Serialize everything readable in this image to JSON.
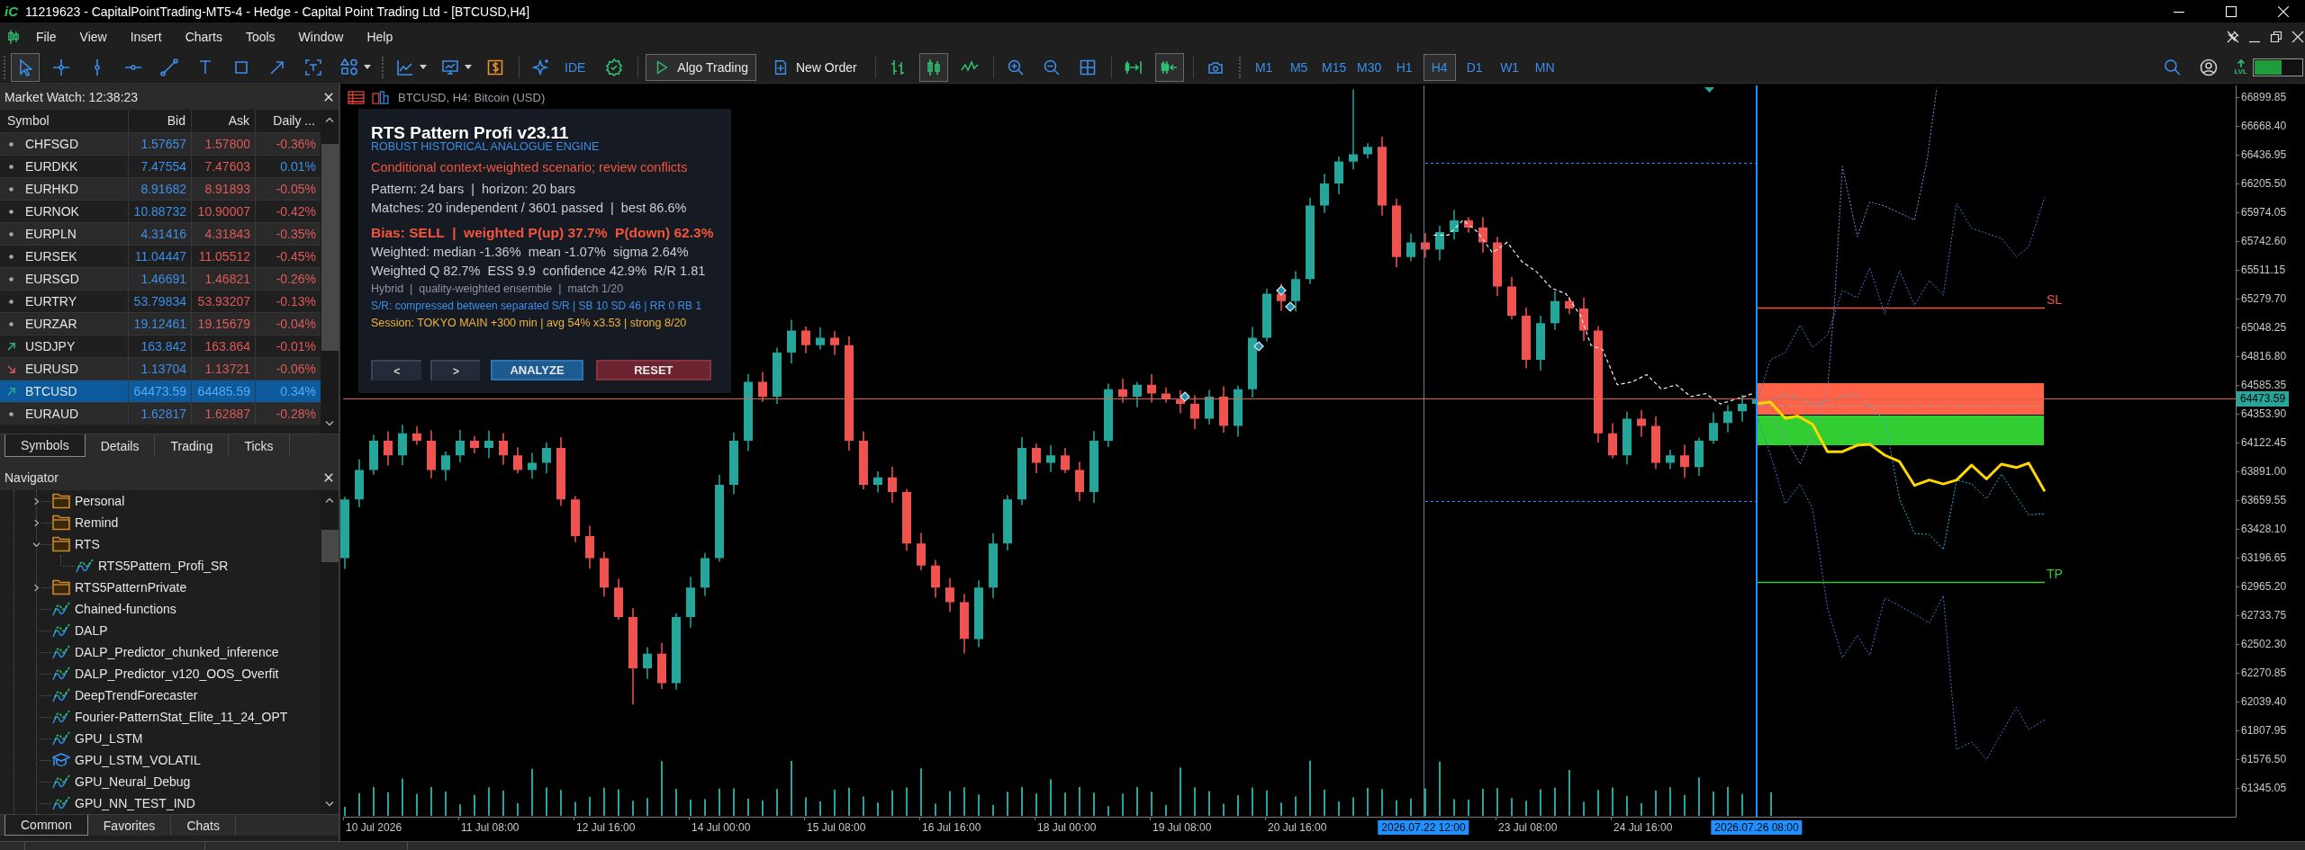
{
  "title_bar": {
    "logo": "iC",
    "title": "11219623 - CapitalPointTrading-MT5-4 - Hedge - Capital Point Trading Ltd - [BTCUSD,H4]"
  },
  "menu": [
    "File",
    "View",
    "Insert",
    "Charts",
    "Tools",
    "Window",
    "Help"
  ],
  "toolbar": {
    "drawing_tools": [
      {
        "kind": "cursor",
        "selected": true
      },
      {
        "kind": "crosshair",
        "selected": false
      },
      {
        "kind": "vline",
        "selected": false
      },
      {
        "kind": "hline",
        "selected": false
      },
      {
        "kind": "trendline",
        "selected": false
      },
      {
        "kind": "text",
        "selected": false
      },
      {
        "kind": "rectangle",
        "selected": false
      },
      {
        "kind": "arrow",
        "selected": false
      },
      {
        "kind": "textframe",
        "selected": false
      },
      {
        "kind": "shapes",
        "selected": false
      }
    ],
    "ide": "IDE",
    "algo_trading": "Algo Trading",
    "new_order": "New Order",
    "chart_types": [
      {
        "kind": "bars",
        "selected": false
      },
      {
        "kind": "candles",
        "selected": true
      },
      {
        "kind": "line",
        "selected": false
      }
    ],
    "chart_shift": false,
    "auto_scroll": true,
    "timeframes": [
      {
        "label": "M1",
        "selected": false
      },
      {
        "label": "M5",
        "selected": false
      },
      {
        "label": "M15",
        "selected": false
      },
      {
        "label": "M30",
        "selected": false
      },
      {
        "label": "H1",
        "selected": false
      },
      {
        "label": "H4",
        "selected": true
      },
      {
        "label": "D1",
        "selected": false
      },
      {
        "label": "W1",
        "selected": false
      },
      {
        "label": "MN",
        "selected": false
      }
    ],
    "level_label": "LVL"
  },
  "market_watch": {
    "title": "Market Watch: 12:38:23",
    "columns": [
      "Symbol",
      "Bid",
      "Ask",
      "Daily ..."
    ],
    "rows": [
      {
        "kind": "flat",
        "symbol": "CHFSGD",
        "bid": "1.57657",
        "ask": "1.57800",
        "daily": "-0.36%",
        "positive": false,
        "selected": false
      },
      {
        "kind": "flat",
        "symbol": "EURDKK",
        "bid": "7.47554",
        "ask": "7.47603",
        "daily": "0.01%",
        "positive": true,
        "selected": false
      },
      {
        "kind": "flat",
        "symbol": "EURHKD",
        "bid": "8.91682",
        "ask": "8.91893",
        "daily": "-0.05%",
        "positive": false,
        "selected": false
      },
      {
        "kind": "flat",
        "symbol": "EURNOK",
        "bid": "10.88732",
        "ask": "10.90007",
        "daily": "-0.42%",
        "positive": false,
        "selected": false
      },
      {
        "kind": "flat",
        "symbol": "EURPLN",
        "bid": "4.31416",
        "ask": "4.31843",
        "daily": "-0.35%",
        "positive": false,
        "selected": false
      },
      {
        "kind": "flat",
        "symbol": "EURSEK",
        "bid": "11.04447",
        "ask": "11.05512",
        "daily": "-0.45%",
        "positive": false,
        "selected": false
      },
      {
        "kind": "flat",
        "symbol": "EURSGD",
        "bid": "1.46691",
        "ask": "1.46821",
        "daily": "-0.26%",
        "positive": false,
        "selected": false
      },
      {
        "kind": "flat",
        "symbol": "EURTRY",
        "bid": "53.79834",
        "ask": "53.93207",
        "daily": "-0.13%",
        "positive": false,
        "selected": false
      },
      {
        "kind": "flat",
        "symbol": "EURZAR",
        "bid": "19.12461",
        "ask": "19.15679",
        "daily": "-0.04%",
        "positive": false,
        "selected": false
      },
      {
        "kind": "up",
        "symbol": "USDJPY",
        "bid": "163.842",
        "ask": "163.864",
        "daily": "-0.01%",
        "positive": false,
        "selected": false
      },
      {
        "kind": "down",
        "symbol": "EURUSD",
        "bid": "1.13704",
        "ask": "1.13721",
        "daily": "-0.06%",
        "positive": false,
        "selected": false
      },
      {
        "kind": "up",
        "symbol": "BTCUSD",
        "bid": "64473.59",
        "ask": "64485.59",
        "daily": "0.34%",
        "positive": true,
        "selected": true
      },
      {
        "kind": "flat",
        "symbol": "EURAUD",
        "bid": "1.62817",
        "ask": "1.62887",
        "daily": "-0.28%",
        "positive": false,
        "selected": false
      }
    ],
    "tabs": [
      {
        "label": "Symbols",
        "selected": true
      },
      {
        "label": "Details",
        "selected": false
      },
      {
        "label": "Trading",
        "selected": false
      },
      {
        "label": "Ticks",
        "selected": false
      }
    ]
  },
  "navigator": {
    "title": "Navigator",
    "items": [
      {
        "kind": "folder",
        "label": "Personal",
        "expanded": false
      },
      {
        "kind": "folder",
        "label": "Remind",
        "expanded": false
      },
      {
        "kind": "folder",
        "label": "RTS",
        "expanded": true,
        "children": [
          {
            "kind": "indicator",
            "label": "RTS5Pattern_Profi_SR"
          }
        ]
      },
      {
        "kind": "folder",
        "label": "RTS5PatternPrivate",
        "expanded": false
      },
      {
        "kind": "indicator",
        "label": "Chained-functions"
      },
      {
        "kind": "indicator",
        "label": "DALP"
      },
      {
        "kind": "indicator",
        "label": "DALP_Predictor_chunked_inference"
      },
      {
        "kind": "indicator",
        "label": "DALP_Predictor_v120_OOS_Overfit"
      },
      {
        "kind": "indicator",
        "label": "DeepTrendForecaster"
      },
      {
        "kind": "indicator",
        "label": "Fourier-PatternStat_Elite_11_24_OPT"
      },
      {
        "kind": "indicator",
        "label": "GPU_LSTM"
      },
      {
        "kind": "expert",
        "label": "GPU_LSTM_VOLATIL"
      },
      {
        "kind": "indicator",
        "label": "GPU_Neural_Debug"
      },
      {
        "kind": "indicator",
        "label": "GPU_NN_TEST_IND"
      }
    ],
    "tabs": [
      {
        "label": "Common",
        "selected": true
      },
      {
        "label": "Favorites",
        "selected": false
      },
      {
        "label": "Chats",
        "selected": false
      }
    ]
  },
  "chart": {
    "header": "BTCUSD, H4: Bitcoin (USD)",
    "price_labels": [
      "66899.85",
      "66668.40",
      "66436.95",
      "66205.50",
      "65974.05",
      "65742.60",
      "65511.15",
      "65279.70",
      "65048.25",
      "64816.80",
      "64585.35",
      "64353.90",
      "64122.45",
      "63891.00",
      "63659.55",
      "63428.10",
      "63196.65",
      "62965.20",
      "62733.75",
      "62502.30",
      "62270.85",
      "62039.40",
      "61807.95",
      "61576.50",
      "61345.05"
    ],
    "current_price": "64473.59",
    "time_labels": [
      "10 Jul 2026",
      "11 Jul 08:00",
      "12 Jul 16:00",
      "14 Jul 00:00",
      "15 Jul 08:00",
      "16 Jul 16:00",
      "18 Jul 00:00",
      "19 Jul 08:00",
      "20 Jul 16:00",
      "23 Jul 08:00",
      "24 Jul 16:00"
    ],
    "time_markers": [
      "2026.07.22 12:00",
      "2026.07.26 08:00"
    ],
    "stop_loss_label": "SL",
    "take_profit_label": "TP"
  },
  "panel": {
    "title": "RTS Pattern Profi v23.11",
    "subtitle": "ROBUST HISTORICAL ANALOGUE ENGINE",
    "lines": [
      {
        "kind": "warning",
        "text": "Conditional context-weighted scenario; review conflicts"
      },
      {
        "kind": "stat",
        "text": "Pattern: 24 bars  |  horizon: 20 bars"
      },
      {
        "kind": "stat",
        "text": "Matches: 20 independent / 3601 passed  |  best 86.6%"
      },
      {
        "kind": "bias",
        "text": "Bias: SELL  |  weighted P(up) 37.7%  P(down) 62.3%"
      },
      {
        "kind": "stat",
        "text": "Weighted: median -1.36%  mean -1.07%  sigma 2.64%"
      },
      {
        "kind": "stat",
        "text": "Weighted Q 82.7%  ESS 9.9  confidence 42.9%  R/R 1.81"
      },
      {
        "kind": "note",
        "text": "Hybrid  |  quality-weighted ensemble  |  match 1/20"
      },
      {
        "kind": "sr",
        "text": "S/R: compressed between separated S/R | SB 10 SD 46 | RR 0 RB 1"
      },
      {
        "kind": "session",
        "text": "Session: TOKYO MAIN +300 min | avg 54% x3.53 | strong 8/20"
      }
    ],
    "buttons": [
      {
        "kind": "prev",
        "label": "<"
      },
      {
        "kind": "next",
        "label": ">"
      },
      {
        "kind": "analyze",
        "label": "ANALYZE"
      },
      {
        "kind": "reset",
        "label": "RESET"
      }
    ]
  }
}
